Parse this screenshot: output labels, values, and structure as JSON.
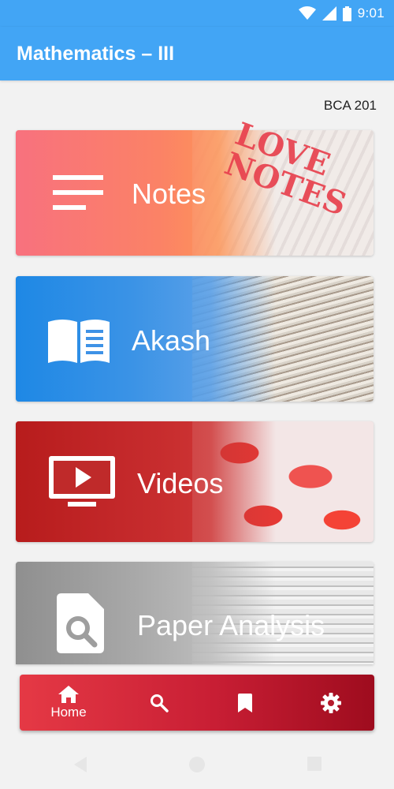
{
  "status_bar": {
    "time": "9:01",
    "icons": [
      "wifi-icon",
      "cell-signal-icon",
      "battery-icon"
    ]
  },
  "app_bar": {
    "title": "Mathematics – III"
  },
  "course_code": "BCA 201",
  "cards": [
    {
      "label": "Notes",
      "icon": "notes-lines-icon",
      "image_text": "LOVE NOTES"
    },
    {
      "label": "Akash",
      "icon": "open-book-icon"
    },
    {
      "label": "Videos",
      "icon": "video-screen-icon"
    },
    {
      "label": "Paper Analysis",
      "icon": "document-search-icon"
    }
  ],
  "bottom_nav": {
    "items": [
      {
        "label": "Home",
        "icon": "home-icon",
        "active": true
      },
      {
        "label": "",
        "icon": "search-icon"
      },
      {
        "label": "",
        "icon": "bookmark-icon"
      },
      {
        "label": "",
        "icon": "settings-gear-icon"
      }
    ]
  },
  "system_nav": [
    "back-icon",
    "home-circle-icon",
    "recents-icon"
  ],
  "colors": {
    "primary": "#42a5f5",
    "notes_card": "#f8717e",
    "akash_card": "#1e88e5",
    "videos_card": "#b71c1c",
    "paper_card": "#9e9e9e",
    "bottom_nav": "#c81e34"
  }
}
